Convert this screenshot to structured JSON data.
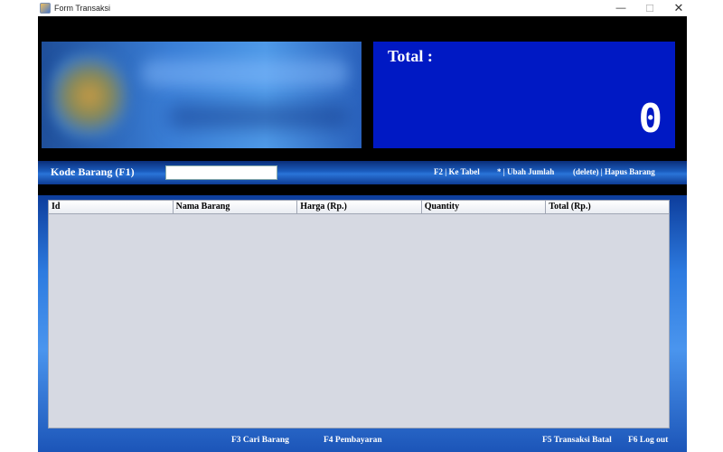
{
  "window": {
    "title": "Form Transaksi",
    "minimize_glyph": "—",
    "maximize_glyph": "☐",
    "close_glyph": "✕"
  },
  "total": {
    "label": "Total :",
    "value": "0"
  },
  "kode_barang": {
    "label": "Kode Barang (F1)",
    "input_value": ""
  },
  "shortcuts": {
    "ke_tabel": "F2 | Ke Tabel",
    "ubah_jumlah": "* | Ubah Jumlah",
    "hapus_barang": "(delete) | Hapus Barang"
  },
  "table": {
    "columns": [
      "Id",
      "Nama Barang",
      "Harga (Rp.)",
      "Quantity",
      "Total (Rp.)"
    ],
    "rows": []
  },
  "footer": {
    "cari_barang": "F3 Cari Barang",
    "pembayaran": "F4 Pembayaran",
    "transaksi_batal": "F5 Transaksi Batal",
    "log_out": "F6 Log out"
  },
  "colors": {
    "total_panel": "#0019c4",
    "window_bg": "#000000",
    "table_bg": "#d6d9e2"
  }
}
